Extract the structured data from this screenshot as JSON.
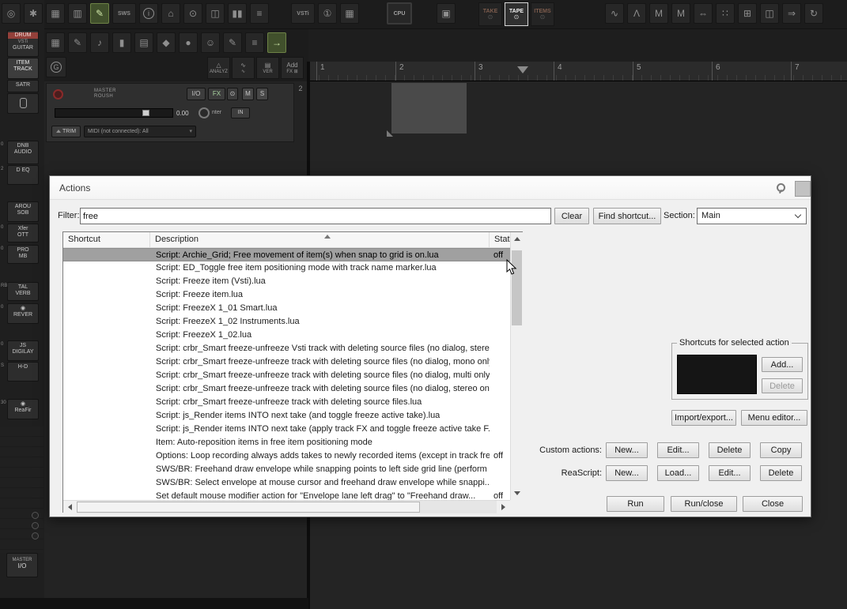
{
  "reaper": {
    "t1g1": [
      {
        "n": "media-explorer-icon",
        "g": "◎"
      },
      {
        "n": "settings-gear-icon",
        "g": "✱"
      },
      {
        "n": "save-project-icon",
        "g": "▦"
      },
      {
        "n": "trash-icon",
        "g": "▥"
      },
      {
        "n": "pencil-tool-icon",
        "g": "✎",
        "cls": "hl"
      },
      {
        "n": "sws-icon",
        "g": "SWS",
        "cls": "txt"
      },
      {
        "n": "info-icon",
        "g": "i",
        "cls": "circ"
      },
      {
        "n": "home-icon",
        "g": "⌂"
      },
      {
        "n": "zoom-icon",
        "g": "⊙"
      },
      {
        "n": "docker-icon",
        "g": "◫"
      },
      {
        "n": "meters-icon",
        "g": "▮▮"
      },
      {
        "n": "mixer-icon",
        "g": "≡"
      }
    ],
    "t1g2": [
      {
        "n": "vsti-dropdown",
        "g": "VSTi",
        "cls": "txt"
      },
      {
        "n": "insert-item-icon",
        "g": "①"
      },
      {
        "n": "grid-icon",
        "g": "▦"
      }
    ],
    "t1g3": [
      {
        "n": "cpu-meter-button",
        "g": "CPU",
        "cls": "cpu txt"
      }
    ],
    "t1g4": [
      {
        "n": "monitor-icon",
        "g": "▣"
      }
    ],
    "t1g5": [
      {
        "n": "take-mode-button",
        "top": "TAKE",
        "bottom": "⊙",
        "cls": "dim"
      },
      {
        "n": "tape-mode-button",
        "top": "TAPE",
        "bottom": "⊙",
        "cls": "active"
      },
      {
        "n": "items-mode-button",
        "top": "ITEMS",
        "bottom": "⊙",
        "cls": "dim"
      }
    ],
    "t1g6": [
      {
        "n": "razor-edit-icon",
        "g": "∿"
      },
      {
        "n": "envelope-icon",
        "g": "Λ"
      },
      {
        "n": "marker-a-icon",
        "g": "M"
      },
      {
        "n": "marker-b-icon",
        "g": "M"
      },
      {
        "n": "stretch-icon",
        "g": "⇔"
      },
      {
        "n": "grid-dots-icon",
        "g": "∷"
      },
      {
        "n": "snap-grid-icon",
        "g": "⊞"
      },
      {
        "n": "duplicate-icon",
        "g": "◫"
      },
      {
        "n": "render-icon",
        "g": "⇒"
      },
      {
        "n": "refresh-icon",
        "g": "↻"
      }
    ],
    "t2": [
      {
        "n": "drum-pads-icon",
        "g": "▦"
      },
      {
        "n": "quill-icon",
        "g": "✎"
      },
      {
        "n": "guitar-icon",
        "g": "♪"
      },
      {
        "n": "piano-roll-icon",
        "g": "▮"
      },
      {
        "n": "step-sequencer-icon",
        "g": "▤"
      },
      {
        "n": "metronome-icon",
        "g": "◆"
      },
      {
        "n": "microphone-icon",
        "g": "●"
      },
      {
        "n": "vocalist-icon",
        "g": "☺"
      },
      {
        "n": "draw-icon",
        "g": "✎"
      },
      {
        "n": "fader-icon",
        "g": "≡"
      },
      {
        "n": "route-arrow-icon",
        "g": "→",
        "cls": "hl"
      }
    ],
    "g_button": "G",
    "t3": [
      {
        "n": "analyze-button",
        "top": "△",
        "bottom": "ANALYZ"
      },
      {
        "n": "freehand-icon",
        "top": "∿",
        "bottom": "∿"
      },
      {
        "n": "version-button",
        "top": "▤",
        "bottom": "VER"
      },
      {
        "n": "add-fx-button",
        "top": "Add",
        "bottom": "FX ⊞"
      }
    ],
    "timeline": [
      "1",
      "2",
      "3",
      "4",
      "5",
      "6",
      "7"
    ],
    "master": {
      "name_top": "MASTER",
      "name_bottom": "ROUSH",
      "io": "I/O",
      "fx": "FX",
      "power": "⊙",
      "mute": "M",
      "solo": "S",
      "volume": "0.00",
      "knob_label": "nter",
      "input_label": "IN",
      "trim": "TRIM",
      "midi": "MIDI (not connected): All",
      "next_track_number": "2"
    },
    "sidebar": [
      {
        "n": "sidebar-item-drum-guitar",
        "mini": "",
        "lines": [
          "DRUM",
          "VSTi",
          "GUITAR"
        ],
        "cls": "drum3"
      },
      {
        "n": "sidebar-item-item-track",
        "mini": "",
        "lines": [
          "ITEM",
          "TRACK"
        ],
        "cls": "lit"
      },
      {
        "n": "sidebar-item-satr",
        "mini": "",
        "lines": [
          "SATR"
        ]
      },
      {
        "n": "sidebar-item-mic",
        "mini": "",
        "lines": [
          ""
        ],
        "cls": "microw"
      },
      {
        "n": "sidebar-item-dnb-audio",
        "mini": "0",
        "lines": [
          "DNB",
          "AUDIO"
        ]
      },
      {
        "n": "sidebar-item-deq",
        "mini": "2",
        "lines": [
          "D EQ"
        ]
      },
      {
        "n": "sidebar-item-arou-sob",
        "mini": "",
        "lines": [
          "AROU",
          "SOB"
        ]
      },
      {
        "n": "sidebar-item-ott",
        "mini": "0",
        "lines": [
          "Xfer",
          "OTT"
        ]
      },
      {
        "n": "sidebar-item-pro-mb",
        "mini": "0",
        "lines": [
          "PRO",
          "MB"
        ]
      },
      {
        "n": "sidebar-item-tal-verb",
        "mini": "RB",
        "lines": [
          "TAL",
          "VERB"
        ]
      },
      {
        "n": "sidebar-item-rever",
        "mini": "0",
        "lines": [
          "◉",
          "REVER"
        ]
      },
      {
        "n": "sidebar-item-js-digilay",
        "mini": "0",
        "lines": [
          "JS",
          "DIGILAY"
        ]
      },
      {
        "n": "sidebar-item-hd",
        "mini": "S",
        "lines": [
          "H-D"
        ]
      },
      {
        "n": "sidebar-item-reafir",
        "mini": "30",
        "lines": [
          "◉",
          "ReaFir"
        ]
      }
    ],
    "master_io": {
      "top": "MASTER",
      "bottom": "I/O"
    }
  },
  "dialog": {
    "title": "Actions",
    "filter_label": "Filter:",
    "filter_value": "free",
    "clear": "Clear",
    "find_shortcut": "Find shortcut...",
    "section_label": "Section:",
    "section_value": "Main",
    "columns": [
      "Shortcut",
      "Description",
      "Stat"
    ],
    "rows": [
      {
        "desc": "Script: Archie_Grid;  Free movement of item(s) when snap to grid is on.lua",
        "stat": "off",
        "cls": "selected"
      },
      {
        "desc": "Script: ED_Toggle free item positioning mode with track name marker.lua",
        "stat": ""
      },
      {
        "desc": "Script: Freeze item (Vsti).lua",
        "stat": ""
      },
      {
        "desc": "Script: Freeze item.lua",
        "stat": ""
      },
      {
        "desc": "Script: FreezeX 1_01 Smart.lua",
        "stat": ""
      },
      {
        "desc": "Script: FreezeX 1_02 Instruments.lua",
        "stat": ""
      },
      {
        "desc": "Script: FreezeX 1_02.lua",
        "stat": ""
      },
      {
        "desc": "Script: crbr_Smart freeze-unfreeze Vsti track with deleting source files (no dialog, stere...",
        "stat": ""
      },
      {
        "desc": "Script: crbr_Smart freeze-unfreeze track with deleting source files (no dialog, mono only...",
        "stat": ""
      },
      {
        "desc": "Script: crbr_Smart freeze-unfreeze track with deleting source files (no dialog, multi only)...",
        "stat": ""
      },
      {
        "desc": "Script: crbr_Smart freeze-unfreeze track with deleting source files (no dialog, stereo onl...",
        "stat": ""
      },
      {
        "desc": "Script: crbr_Smart freeze-unfreeze track with deleting source files.lua",
        "stat": ""
      },
      {
        "desc": "Script: js_Render items INTO next take (and toggle freeze active take).lua",
        "stat": ""
      },
      {
        "desc": "Script: js_Render items INTO next take (apply track FX and toggle freeze active take F...",
        "stat": ""
      },
      {
        "desc": "Item: Auto-reposition items in free item positioning mode",
        "stat": ""
      },
      {
        "desc": "Options: Loop recording always adds takes to newly recorded items (except in track fre...",
        "stat": "off"
      },
      {
        "desc": "SWS/BR: Freehand draw envelope while snapping points to left side grid line (perform ...",
        "stat": ""
      },
      {
        "desc": "SWS/BR: Select envelope at mouse cursor and freehand draw envelope while snappi...",
        "stat": ""
      },
      {
        "desc": "Set default mouse modifier action for \"Envelope lane left drag\" to \"Freehand draw...",
        "stat": "off"
      }
    ],
    "shortcuts_group": {
      "title": "Shortcuts for selected action",
      "add": "Add...",
      "delete": "Delete"
    },
    "import_export": "Import/export...",
    "menu_editor": "Menu editor...",
    "custom_actions_label": "Custom actions:",
    "custom_actions": [
      {
        "label": "New...",
        "n": "custom-new-button"
      },
      {
        "label": "Edit...",
        "n": "custom-edit-button"
      },
      {
        "label": "Delete",
        "n": "custom-delete-button"
      },
      {
        "label": "Copy",
        "n": "custom-copy-button"
      }
    ],
    "reascript_label": "ReaScript:",
    "reascript": [
      {
        "label": "New...",
        "n": "reascript-new-button"
      },
      {
        "label": "Load...",
        "n": "reascript-load-button"
      },
      {
        "label": "Edit...",
        "n": "reascript-edit-button"
      },
      {
        "label": "Delete",
        "n": "reascript-delete-button"
      }
    ],
    "run": "Run",
    "run_close": "Run/close",
    "close": "Close"
  }
}
